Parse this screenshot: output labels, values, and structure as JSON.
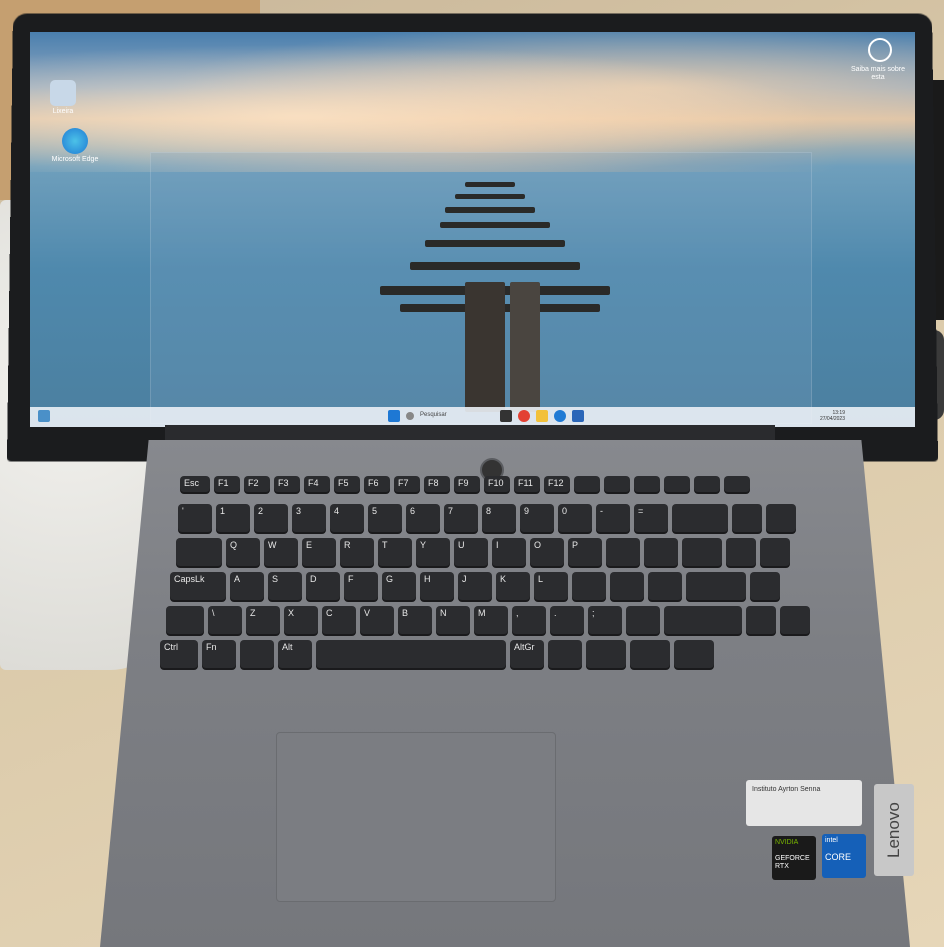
{
  "desktop": {
    "icons": [
      {
        "label": "Lixeira"
      },
      {
        "label": "Microsoft Edge"
      }
    ],
    "corner_label": "Saiba mais sobre esta",
    "taskbar": {
      "search_placeholder": "Pesquisar",
      "clock_time": "13:19",
      "clock_date": "27/04/2023",
      "lang": "POR"
    }
  },
  "keyboard": {
    "rows": [
      [
        "Esc",
        "F1",
        "F2",
        "F3",
        "F4",
        "F5",
        "F6",
        "F7",
        "F8",
        "F9",
        "F10",
        "F11",
        "F12",
        "",
        "",
        "",
        "",
        "",
        ""
      ],
      [
        "'",
        "1",
        "2",
        "3",
        "4",
        "5",
        "6",
        "7",
        "8",
        "9",
        "0",
        "-",
        "=",
        "",
        "",
        "",
        ""
      ],
      [
        "",
        "Q",
        "W",
        "E",
        "R",
        "T",
        "Y",
        "U",
        "I",
        "O",
        "P",
        "",
        "",
        "",
        "",
        "",
        ""
      ],
      [
        "CapsLk",
        "A",
        "S",
        "D",
        "F",
        "G",
        "H",
        "J",
        "K",
        "L",
        "",
        "",
        "",
        "",
        "",
        "",
        ""
      ],
      [
        "",
        "\\",
        "Z",
        "X",
        "C",
        "V",
        "B",
        "N",
        "M",
        ",",
        ".",
        ";",
        "",
        "",
        "",
        "",
        ""
      ],
      [
        "Ctrl",
        "Fn",
        "",
        "Alt",
        "",
        "AltGr",
        "",
        "",
        "",
        ""
      ]
    ]
  },
  "stickers": {
    "senna": "Instituto Ayrton Senna",
    "nvidia": "NVIDIA",
    "geforce": "GEFORCE RTX",
    "intel": "intel",
    "core": "CORE",
    "lenovo": "Lenovo"
  }
}
